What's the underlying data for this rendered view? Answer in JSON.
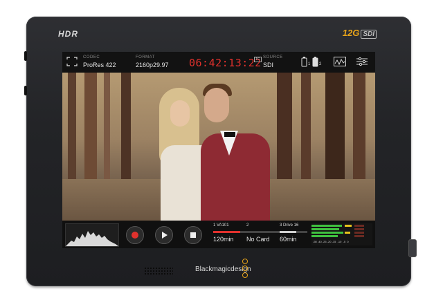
{
  "device": {
    "hdr_logo": "HDR",
    "sdi_logo_main": "12G",
    "sdi_logo_badge": "SDI",
    "brand": "Blackmagicdesign"
  },
  "topbar": {
    "codec_label": "CODEC",
    "codec_value": "ProRes 422",
    "format_label": "FORMAT",
    "format_value": "2160p29.97",
    "timecode": "06:42:13:22",
    "tc_badge": "TC",
    "source_label": "SOURCE",
    "source_value": "SDI",
    "battery_1": "1",
    "battery_2": "2",
    "icons": [
      "fullscreen-icon",
      "battery-icon",
      "scope-icon",
      "settings-sliders-icon"
    ]
  },
  "bottombar": {
    "slots": [
      {
        "label": "1  VA101",
        "value": "120min",
        "fill_color": "#e0312d",
        "level": 0.7
      },
      {
        "label": "2",
        "value": "No Card",
        "fill_color": "#444444",
        "level": 0
      },
      {
        "label": "3  Drive 16",
        "value": "60min",
        "fill_color": "#cfcfcf",
        "level": 0.6
      }
    ],
    "meter_scale": "-50 -40 -25 -20 -15  -10  -5  0"
  },
  "colors": {
    "timecode_red": "#e0312d",
    "record_red": "#e0312d",
    "brand_gold": "#e8a419",
    "meter_green": "#3fc23f",
    "meter_yellow": "#e8c41c"
  }
}
